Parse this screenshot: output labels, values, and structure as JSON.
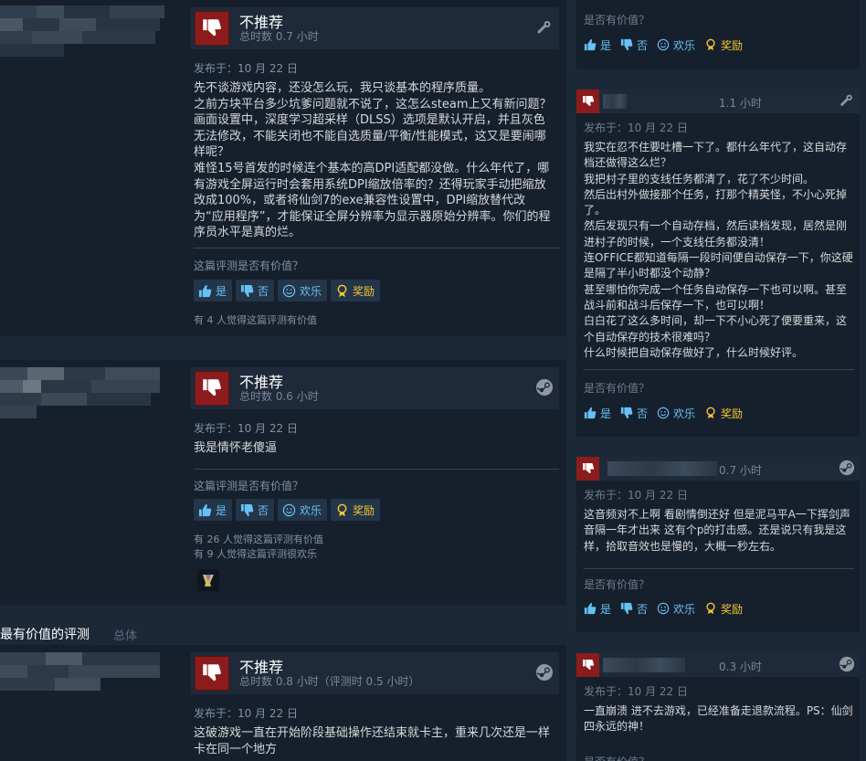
{
  "colors": {
    "accent": "#67c1f5",
    "negative": "#8c1c1c",
    "award": "#f5c531",
    "bg": "#1b2838"
  },
  "vote_labels": {
    "yes": "是",
    "no": "否",
    "funny": "欢乐",
    "award": "奖励"
  },
  "left_reviews": [
    {
      "verdict": "不推荐",
      "hours": "总时数 0.7 小时",
      "posted": "发布于：10 月 22 日",
      "body": "先不谈游戏内容，还没怎么玩，我只谈基本的程序质量。\n之前方块平台多少坑爹问题就不说了，这怎么steam上又有新问题？画面设置中，深度学习超采样（DLSS）选项是默认开启，并且灰色无法修改，不能关闭也不能自选质量/平衡/性能模式，这又是要闹哪样呢？\n难怪15号首发的时候连个基本的高DPI适配都没做。什么年代了，哪有游戏全屏运行时会套用系统DPI缩放倍率的？还得玩家手动把缩放改成100%，或者将仙剑7的exe兼容性设置中，DPI缩放替代改为“应用程序”，才能保证全屏分辨率为显示器原始分辨率。你们的程序员水平是真的烂。",
      "helpful_question": "这篇评测是否有价值？",
      "helpful_counts": [
        "有 4 人觉得这篇评测有价值"
      ],
      "icon": "gear-icon"
    },
    {
      "verdict": "不推荐",
      "hours": "总时数 0.6 小时",
      "posted": "发布于：10 月 22 日",
      "body": "我是情怀老傻逼",
      "helpful_question": "这篇评测是否有价值？",
      "helpful_counts": [
        "有 26 人觉得这篇评测有价值",
        "有 9 人觉得这篇评测很欢乐"
      ],
      "icon": "steam-icon"
    },
    {
      "verdict": "不推荐",
      "hours": "总时数 0.8 小时（评测时 0.5 小时）",
      "posted": "发布于：10 月 22 日",
      "body": "这破游戏一直在开始阶段基础操作还结束就卡主，重来几次还是一样卡在同一个地方",
      "icon": "steam-icon"
    }
  ],
  "section": {
    "title": "最有价值的评测",
    "subtitle": "总体"
  },
  "right_reviews": [
    {
      "hours": "",
      "helpful_question": "是否有价值？"
    },
    {
      "hours": "1.1 小时",
      "posted": "发布于：10 月 22 日",
      "body": "我实在忍不住要吐槽一下了。都什么年代了，这自动存档还做得这么烂？\n我把村子里的支线任务都清了，花了不少时间。\n然后出村外做接那个任务，打那个精英怪，不小心死掉了。\n然后发现只有一个自动存档，然后读档发现，居然是刚进村子的时候，一个支线任务都没清！\n连OFFICE都知道每隔一段时间便自动保存一下，你这硬是隔了半小时都没个动静？\n甚至哪怕你完成一个任务自动保存一下也可以啊。甚至战斗前和战斗后保存一下，也可以啊！\n白白花了这么多时间，却一下不小心死了便要重来，这个自动保存的技术很难吗？\n什么时候把自动保存做好了，什么时候好评。",
      "helpful_question": "是否有价值？",
      "icon": "gear-icon"
    },
    {
      "hours": "0.7 小时",
      "posted": "发布于：10 月 22 日",
      "body": "这音频对不上啊 看剧情倒还好 但是泥马平A一下挥剑声音隔一年才出来 这有个p的打击感。还是说只有我是这样，拾取音效也是慢的，大概一秒左右。",
      "helpful_question": "是否有价值？",
      "icon": "steam-icon"
    },
    {
      "hours": "0.3 小时",
      "posted": "发布于：10 月 22 日",
      "body": "一直崩溃 进不去游戏，已经准备走退款流程。PS：仙剑四永远的神！",
      "helpful_question": "是否有价值？",
      "icon": "steam-icon"
    }
  ]
}
